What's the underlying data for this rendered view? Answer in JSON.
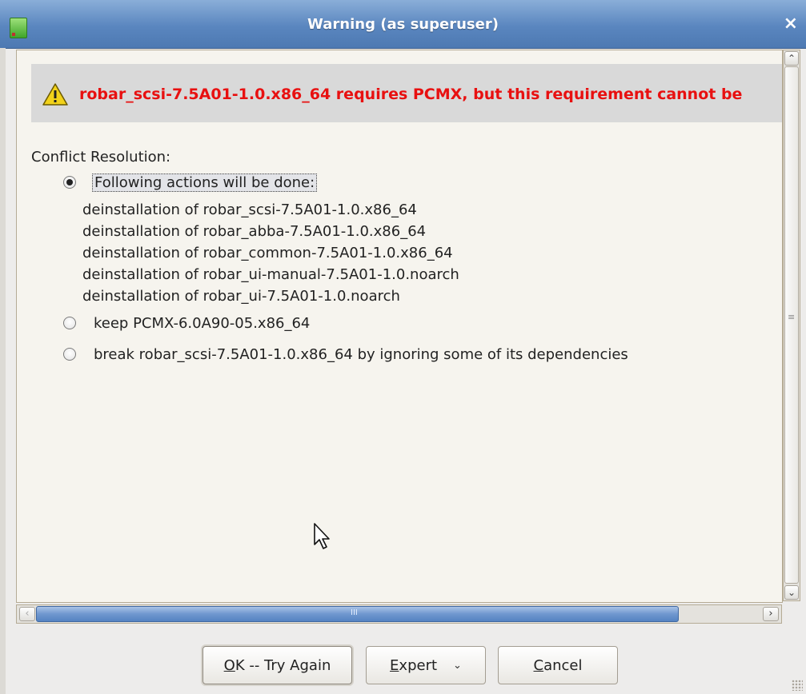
{
  "window": {
    "title": "Warning (as superuser)",
    "close_label": "×"
  },
  "warning": {
    "icon": "warning-triangle-icon",
    "text": "robar_scsi-7.5A01-1.0.x86_64 requires PCMX, but this requirement cannot be",
    "color": "#e81010"
  },
  "conflict": {
    "label": "Conflict Resolution:",
    "options": [
      {
        "label": "Following actions will be done:",
        "selected": true
      },
      {
        "label": "keep PCMX-6.0A90-05.x86_64",
        "selected": false
      },
      {
        "label": "break robar_scsi-7.5A01-1.0.x86_64 by ignoring some of its dependencies",
        "selected": false
      }
    ],
    "actions": [
      "deinstallation of robar_scsi-7.5A01-1.0.x86_64",
      "deinstallation of robar_abba-7.5A01-1.0.x86_64",
      "deinstallation of robar_common-7.5A01-1.0.x86_64",
      "deinstallation of robar_ui-manual-7.5A01-1.0.noarch",
      "deinstallation of robar_ui-7.5A01-1.0.noarch"
    ]
  },
  "buttons": {
    "ok": {
      "mnemonic": "O",
      "rest": "K -- Try Again"
    },
    "expert": {
      "mnemonic": "E",
      "rest": "xpert",
      "chevron": "⌄"
    },
    "cancel": {
      "mnemonic": "C",
      "rest": "ancel"
    }
  },
  "colors": {
    "titlebar": "#5a86bf",
    "accent": "#6f97cf"
  }
}
